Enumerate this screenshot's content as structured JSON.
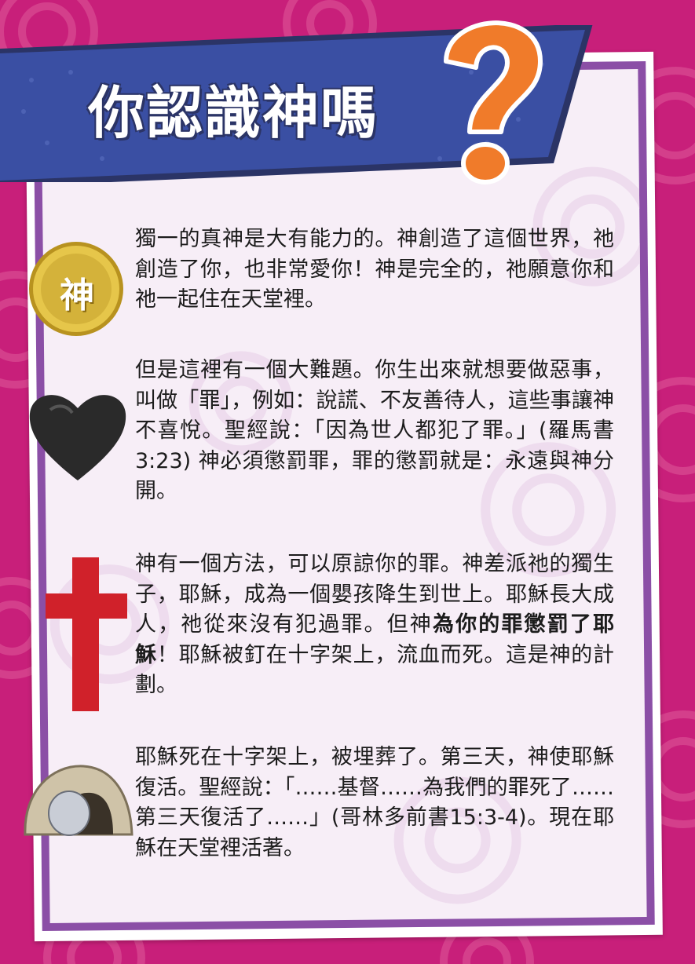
{
  "title": "你認識神嗎",
  "colors": {
    "background": "#c81f7a",
    "banner": "#3a4fa3",
    "card_border": "#8b4fa6",
    "card_fill": "#f7eef7",
    "question_mark": "#f07b2a",
    "cross": "#d0212a",
    "coin": "#d4b23a"
  },
  "coin_label": "神",
  "sections": [
    {
      "icon": "gold-coin-icon",
      "text": "獨一的真神是大有能力的。神創造了這個世界，祂創造了你，也非常愛你！神是完全的，祂願意你和祂一起住在天堂裡。"
    },
    {
      "icon": "black-heart-icon",
      "text": "但是這裡有一個大難題。你生出來就想要做惡事，叫做「罪」，例如：說謊、不友善待人，這些事讓神不喜悅。聖經說：「因為世人都犯了罪。」(羅馬書3:23) 神必須懲罰罪，罪的懲罰就是：永遠與神分開。"
    },
    {
      "icon": "cross-icon",
      "text_before": "神有一個方法，可以原諒你的罪。神差派祂的獨生子，耶穌，成為一個嬰孩降生到世上。耶穌長大成人，祂從來沒有犯過罪。但神",
      "text_bold": "為你的罪懲罰了耶穌",
      "text_after": "！耶穌被釘在十字架上，流血而死。這是神的計劃。"
    },
    {
      "icon": "empty-tomb-icon",
      "text": "耶穌死在十字架上，被埋葬了。第三天，神使耶穌復活。聖經說：「……基督……為我們的罪死了……第三天復活了……」(哥林多前書15:3-4)。現在耶穌在天堂裡活著。"
    }
  ]
}
